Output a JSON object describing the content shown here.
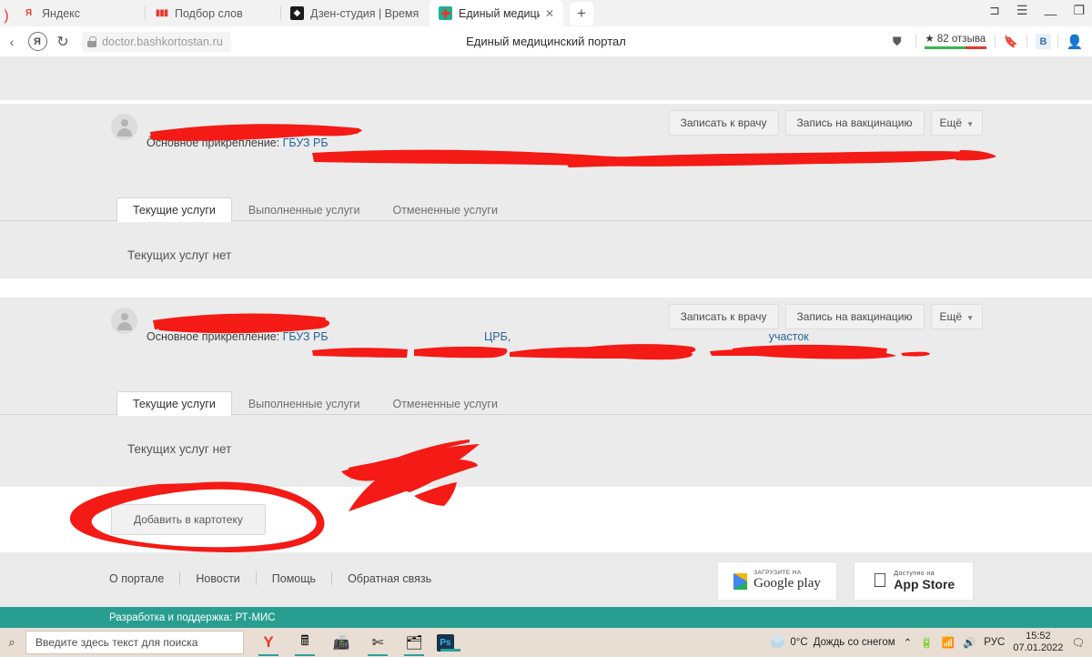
{
  "browser": {
    "tabs": [
      {
        "title": "Яндекс",
        "icon": "yandex-icon",
        "active": false
      },
      {
        "title": "Подбор слов",
        "icon": "bar-chart-icon",
        "active": false
      },
      {
        "title": "Дзен-студия | Время смот",
        "icon": "zen-icon",
        "active": false
      },
      {
        "title": "Единый медицинский п",
        "icon": "medical-cross-icon",
        "active": true
      }
    ],
    "new_tab_label": "+",
    "close_tab_label": "✕",
    "window_controls": {
      "collections": "⊐",
      "menu": "☰",
      "minimize": "—",
      "restore": "❐"
    },
    "address": "doctor.bashkortostan.ru",
    "page_title": "Единый медицинский портал",
    "reviews_label": "★ 82 отзыва",
    "reviews_bar_colors": [
      "#3ab54a",
      "#3ab54a",
      "#e03a2f"
    ],
    "vk_label": "B"
  },
  "cards": [
    {
      "attachment_label": "Основное прикрепление:",
      "attachment_org": "ГБУЗ РБ",
      "buttons": {
        "appointment": "Записать к врачу",
        "vaccination": "Запись на вакцинацию",
        "more": "Ещё"
      },
      "tabs": [
        {
          "label": "Текущие услуги",
          "selected": true
        },
        {
          "label": "Выполненные услуги",
          "selected": false
        },
        {
          "label": "Отмененные услуги",
          "selected": false
        }
      ],
      "empty_message": "Текущих услуг нет"
    },
    {
      "attachment_label": "Основное прикрепление:",
      "attachment_org": "ГБУЗ РБ",
      "attachment_tail_1": "ЦРБ,",
      "attachment_tail_2": "участок",
      "buttons": {
        "appointment": "Записать к врачу",
        "vaccination": "Запись на вакцинацию",
        "more": "Ещё"
      },
      "tabs": [
        {
          "label": "Текущие услуги",
          "selected": true
        },
        {
          "label": "Выполненные услуги",
          "selected": false
        },
        {
          "label": "Отмененные услуги",
          "selected": false
        }
      ],
      "empty_message": "Текущих услуг нет"
    }
  ],
  "add_to_card_file_button": "Добавить в картотеку",
  "footer": {
    "links": [
      "О портале",
      "Новости",
      "Помощь",
      "Обратная связь"
    ],
    "google_play": {
      "small": "ЗАГРУЗИТЕ НА",
      "big": "Google play"
    },
    "app_store": {
      "small": "Доступно на",
      "big": "App Store"
    },
    "developer_line": "Разработка и поддержка: РТ-МИС"
  },
  "taskbar": {
    "search_placeholder": "Введите здесь текст для поиска",
    "apps": [
      "yandex-browser-icon",
      "calculator-icon",
      "scanner-icon",
      "snipping-tool-icon",
      "file-explorer-icon",
      "photoshop-icon"
    ],
    "weather_temp": "0°C",
    "weather_text": "Дождь со снегом",
    "language": "РУС",
    "time": "15:52",
    "date": "07.01.2022"
  },
  "annotation_color": "#f41a15"
}
